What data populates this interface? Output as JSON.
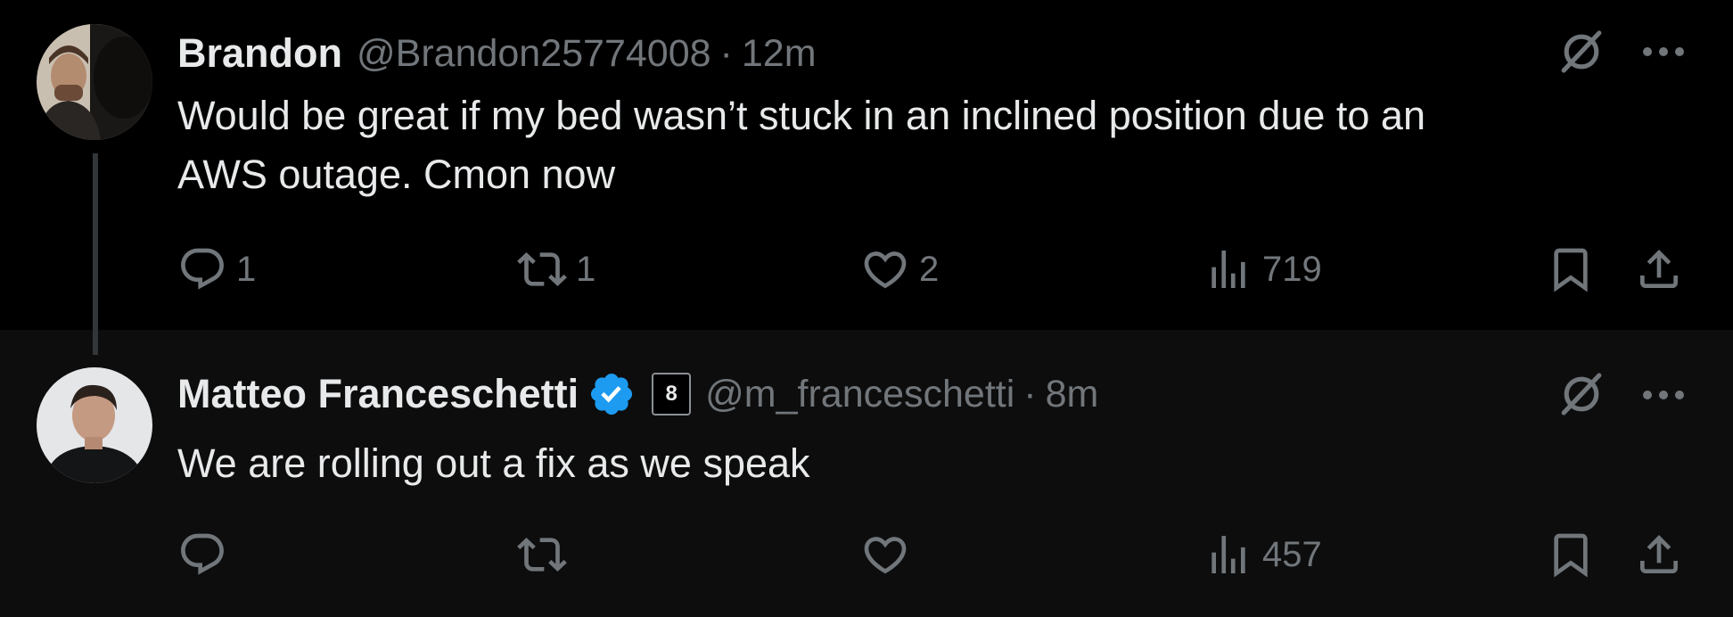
{
  "tweets": [
    {
      "name": "Brandon",
      "handle": "@Brandon25774008",
      "separator": "·",
      "time": "12m",
      "text_lines": [
        "Would be great if my bed wasn’t stuck in an inclined position due to an",
        "AWS outage. Cmon now"
      ],
      "replies": "1",
      "reposts": "1",
      "likes": "2",
      "views": "719"
    },
    {
      "name": "Matteo Franceschetti",
      "verified": true,
      "affiliate_badge": "8",
      "handle": "@m_franceschetti",
      "separator": "·",
      "time": "8m",
      "text_lines": [
        "We are rolling out a fix as we speak"
      ],
      "replies": "",
      "reposts": "",
      "likes": "",
      "views": "457"
    }
  ],
  "colors": {
    "background": "#000000",
    "reply_background": "#0d0d0d",
    "text": "#e7e9ea",
    "muted": "#71767b",
    "verified": "#1d9bf0"
  },
  "icons": [
    "grok-icon",
    "more-icon",
    "reply-icon",
    "repost-icon",
    "like-icon",
    "views-icon",
    "bookmark-icon",
    "share-icon",
    "verified-badge-icon"
  ]
}
